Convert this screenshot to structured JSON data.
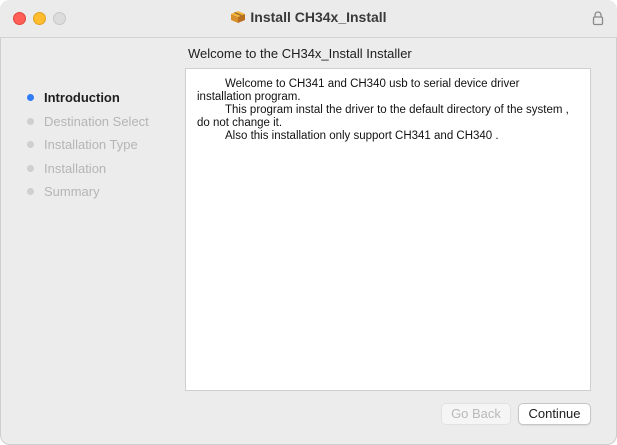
{
  "window": {
    "title": "Install CH34x_Install",
    "title_icon": "package-icon",
    "lock_icon": "lock-icon",
    "traffic_lights": [
      "close",
      "minimize",
      "maximize"
    ]
  },
  "header": {
    "subtitle": "Welcome to the CH34x_Install Installer"
  },
  "sidebar": {
    "steps": [
      {
        "label": "Introduction",
        "active": true
      },
      {
        "label": "Destination Select",
        "active": false
      },
      {
        "label": "Installation Type",
        "active": false
      },
      {
        "label": "Installation",
        "active": false
      },
      {
        "label": "Summary",
        "active": false
      }
    ]
  },
  "content": {
    "para1_line1": "Welcome to CH341 and CH340 usb to serial device driver",
    "para1_line2": "installation program.",
    "para2_line1": "This program instal the driver to the default directory of the system ,",
    "para2_line2": "do not change it.",
    "para3": "Also this installation only support CH341 and CH340 ."
  },
  "buttons": {
    "back": "Go Back",
    "continue": "Continue"
  },
  "colors": {
    "accent": "#2f7cf6",
    "close": "#ff5f57",
    "minimize": "#febc2e"
  }
}
